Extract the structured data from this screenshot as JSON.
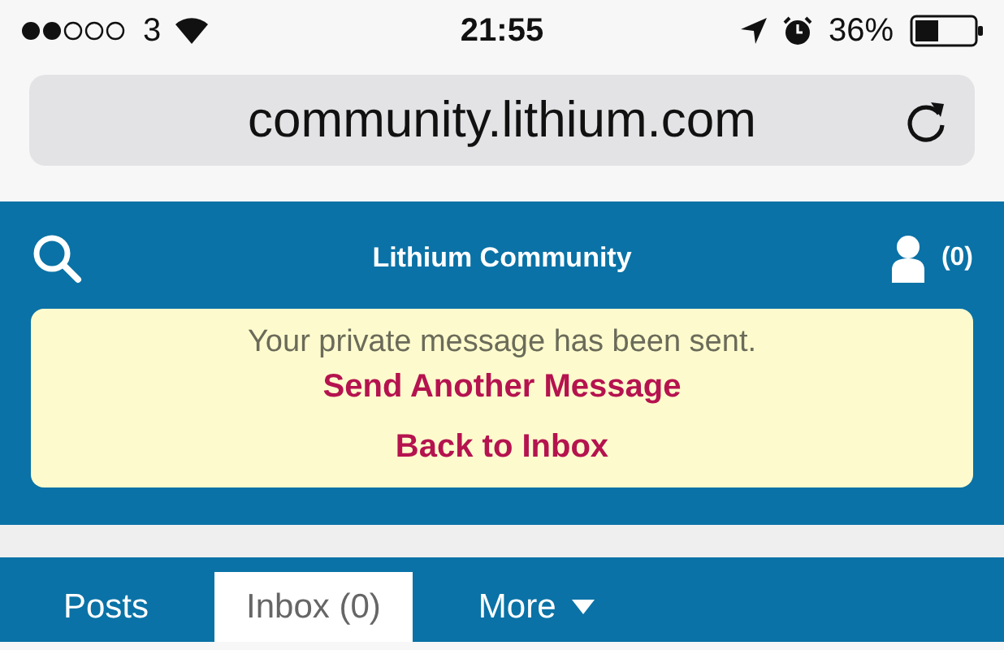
{
  "status_bar": {
    "carrier": "3",
    "time": "21:55",
    "battery": "36%"
  },
  "address_bar": {
    "url": "community.lithium.com"
  },
  "header": {
    "title": "Lithium Community",
    "message_count": "(0)"
  },
  "notice": {
    "text": "Your private message has been sent.",
    "links": [
      "Send Another Message",
      "Back to Inbox"
    ]
  },
  "tabs": [
    {
      "label": "Posts",
      "selected": false,
      "kind": "plain"
    },
    {
      "label": "Inbox (0)",
      "selected": true,
      "kind": "plain"
    },
    {
      "label": "More",
      "selected": false,
      "kind": "dropdown"
    }
  ]
}
